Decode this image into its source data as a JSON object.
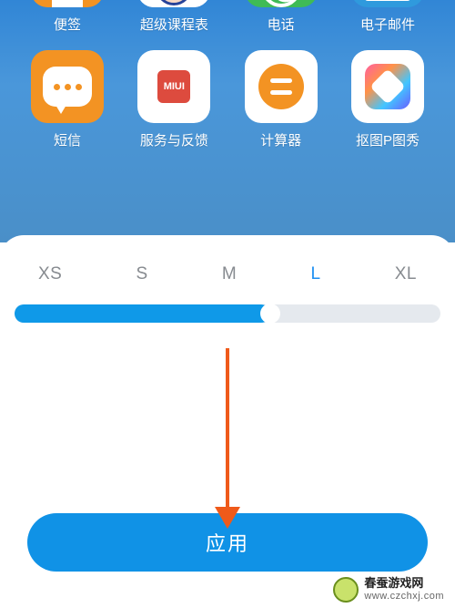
{
  "home": {
    "row1": [
      {
        "label": "便签",
        "name": "notes-app"
      },
      {
        "label": "超级课程表",
        "name": "super-schedule-app"
      },
      {
        "label": "电话",
        "name": "phone-app"
      },
      {
        "label": "电子邮件",
        "name": "email-app"
      }
    ],
    "row2": [
      {
        "label": "短信",
        "name": "sms-app"
      },
      {
        "label": "服务与反馈",
        "name": "feedback-app",
        "miui": "MIUI"
      },
      {
        "label": "计算器",
        "name": "calculator-app"
      },
      {
        "label": "抠图P图秀",
        "name": "photo-edit-app"
      }
    ]
  },
  "sizes": {
    "options": [
      "XS",
      "S",
      "M",
      "L",
      "XL"
    ],
    "active_index": 3,
    "fill_percent": "60%"
  },
  "apply_label": "应用",
  "watermark": {
    "line1": "春蚕游戏网",
    "line2": "www.czchxj.com"
  }
}
